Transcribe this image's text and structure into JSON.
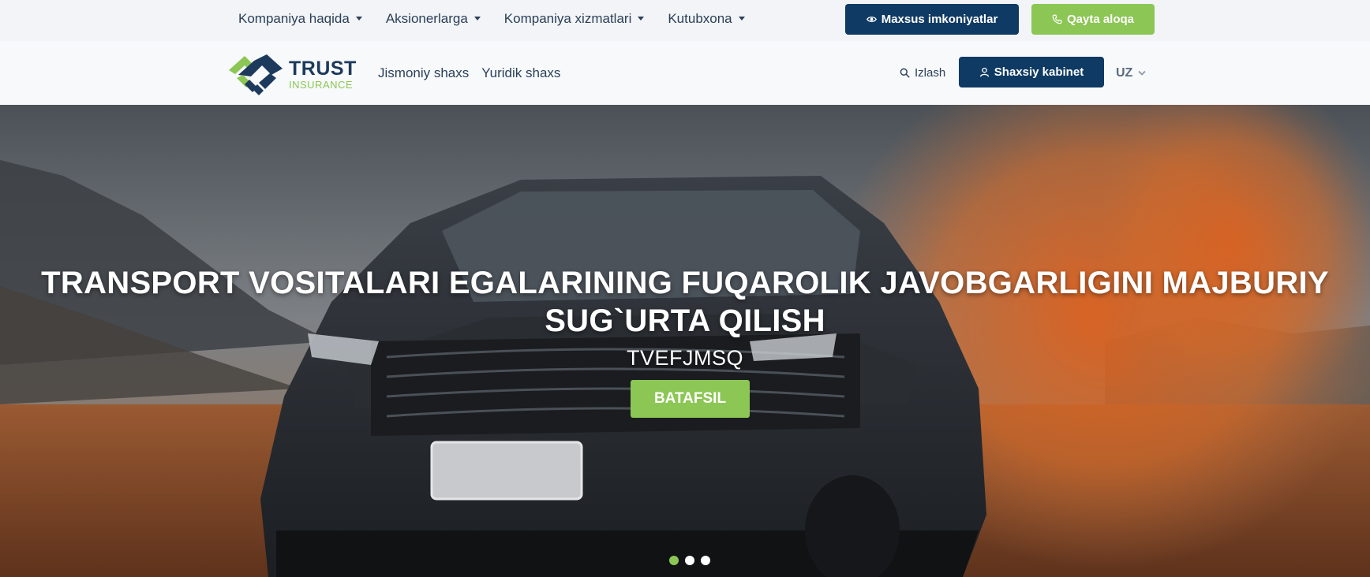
{
  "topbar": {
    "nav": [
      {
        "label": "Kompaniya haqida"
      },
      {
        "label": "Aksionerlarga"
      },
      {
        "label": "Kompaniya xizmatlari"
      },
      {
        "label": "Kutubxona"
      }
    ],
    "special_label": "Maxsus imkoniyatlar",
    "callback_label": "Qayta aloqa"
  },
  "header": {
    "logo": {
      "trust": "TRUST",
      "insurance": "INSURANCE"
    },
    "nav": [
      {
        "label": "Jismoniy shaxs"
      },
      {
        "label": "Yuridik shaxs"
      }
    ],
    "search_label": "Izlash",
    "cabinet_label": "Shaxsiy kabinet",
    "lang": "UZ"
  },
  "hero": {
    "title_line1": "TRANSPORT VOSITALARI EGALARINING FUQAROLIK JAVOBGARLIGINI MAJBURIY",
    "title_line2": "SUG`URTA QILISH",
    "subtitle": "TVEFJMSQ",
    "button_label": "BATAFSIL",
    "slides": 3,
    "active_slide": 1
  },
  "colors": {
    "primary": "#0f3a63",
    "accent": "#8cc654",
    "topbar_bg": "#f2f4f7",
    "header_bg": "#f7f9fb",
    "text": "#2b3f57"
  },
  "icons": {
    "special": "eye-icon",
    "callback": "phone-icon",
    "search": "search-icon",
    "cabinet": "user-icon",
    "lang": "chevron-down-icon"
  }
}
